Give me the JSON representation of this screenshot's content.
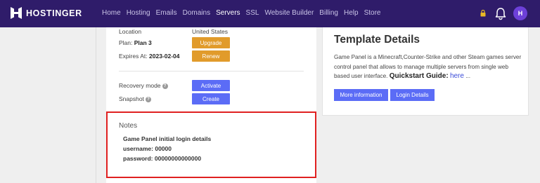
{
  "topnav": {
    "brand": "HOSTINGER",
    "menu": [
      "Home",
      "Hosting",
      "Emails",
      "Domains",
      "Servers",
      "SSL",
      "Website Builder",
      "Billing",
      "Help",
      "Store"
    ],
    "active_menu": "Servers",
    "avatar_initial": "H",
    "colors": {
      "background": "#2f1c6a",
      "avatar": "#6d40d9",
      "lock": "#e9b824"
    }
  },
  "server": {
    "location_label": "Location",
    "location_value": "United States",
    "plan_label": "Plan:",
    "plan_value": "Plan 3",
    "upgrade_label": "Upgrade",
    "expires_label": "Expires At:",
    "expires_value": "2023-02-04",
    "renew_label": "Renew",
    "recovery_label": "Recovery mode",
    "activate_label": "Activate",
    "snapshot_label": "Snapshot",
    "create_label": "Create"
  },
  "notes": {
    "title": "Notes",
    "lines": [
      "Game Panel initial login details",
      "username: 00000",
      "password: 00000000000000"
    ]
  },
  "template": {
    "title": "Template Details",
    "description": "Game Panel is a Minecraft,Counter-Strike and other Steam games server control panel that allows to manage multiple servers from single web based user interface.",
    "quickstart_label": "Quickstart Guide:",
    "quickstart_link": "here",
    "ellipsis": "...",
    "more_info_label": "More information",
    "login_details_label": "Login Details"
  },
  "colors": {
    "orange_button": "#e19b2b",
    "blue_button": "#5b6cf6",
    "highlight_border": "#e02020"
  }
}
